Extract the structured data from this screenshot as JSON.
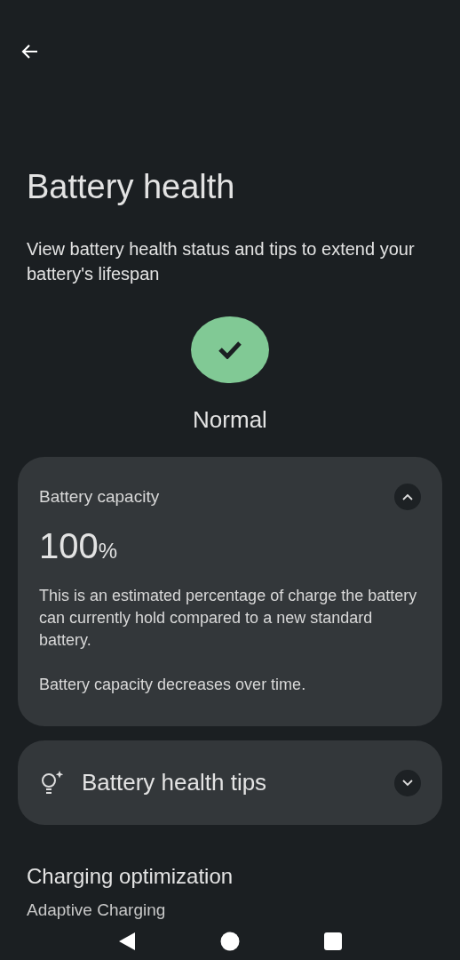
{
  "title": "Battery health",
  "subtitle": "View battery health status and tips to extend your battery's lifespan",
  "status": {
    "label": "Normal",
    "kind": "ok",
    "color": "#81c995"
  },
  "cards": [
    {
      "kind": "capacity",
      "title": "Battery capacity",
      "expanded": true,
      "value": "100",
      "unit": "%",
      "paragraphs": [
        "This is an estimated percentage of charge the battery can currently hold compared to a new standard battery.",
        "Battery capacity decreases over time."
      ]
    },
    {
      "kind": "tips",
      "title": "Battery health tips",
      "expanded": false
    }
  ],
  "section": {
    "title": "Charging optimization",
    "subtitle": "Adaptive Charging"
  }
}
